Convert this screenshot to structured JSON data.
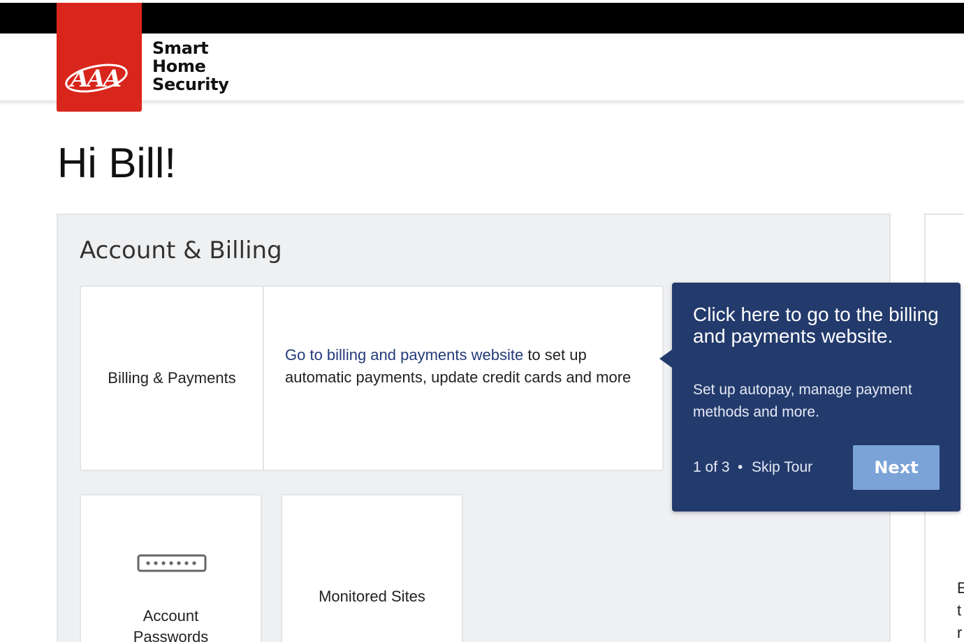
{
  "brand": {
    "logo_text": "AAA",
    "line1": "Smart",
    "line2": "Home",
    "line3": "Security"
  },
  "greeting": "Hi Bill!",
  "account_billing": {
    "title": "Account & Billing",
    "billing_card": {
      "label": "Billing & Payments",
      "link_text": "Go to billing and payments website",
      "description": " to set up automatic payments, update credit cards and more"
    },
    "tiles": [
      {
        "label_line1": "Account",
        "label_line2": "Passwords",
        "icon": "password-field-icon"
      },
      {
        "label": "Monitored Sites"
      }
    ]
  },
  "right_panel_edge_text": [
    "E",
    "t",
    "r"
  ],
  "tour_tooltip": {
    "title": "Click here to go to the billing and payments website.",
    "body": "Set up autopay, manage payment methods and more.",
    "step": "1 of 3",
    "separator": "•",
    "skip_label": "Skip Tour",
    "next_label": "Next"
  },
  "colors": {
    "brand_red": "#d9261c",
    "tooltip_bg": "#233a6c",
    "next_button": "#7ba3d8",
    "link": "#243b7a",
    "panel_bg": "#eff0f2"
  }
}
